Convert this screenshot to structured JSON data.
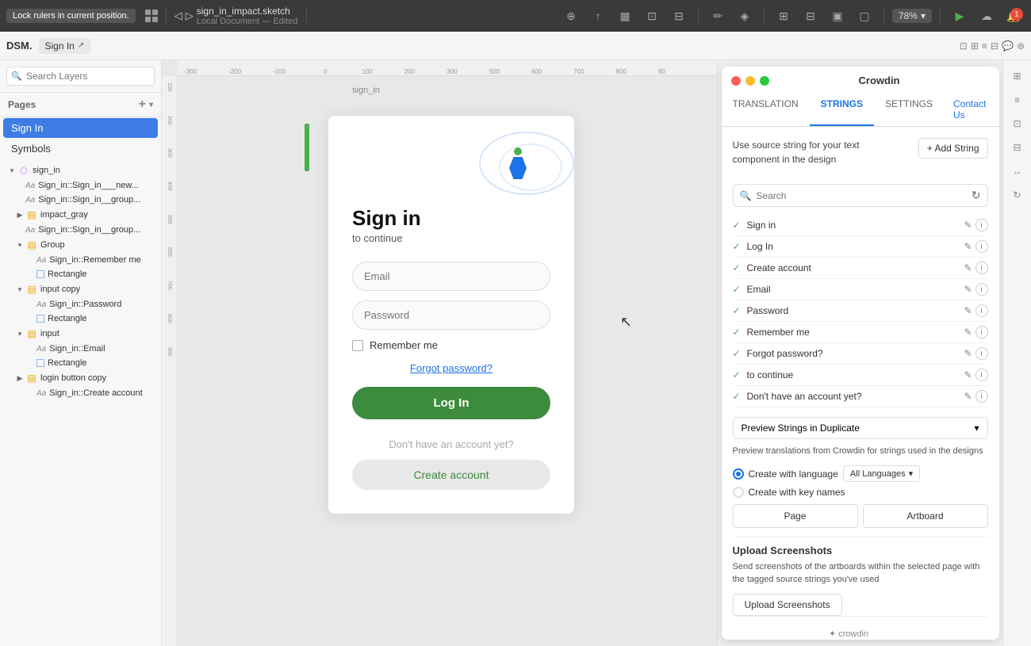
{
  "app": {
    "title": "sign_in_impact.sketch",
    "subtitle": "Local Document — Edited",
    "zoom": "78%"
  },
  "toolbar": {
    "tooltip": "Lock rulers in current position.",
    "add_icon": "+",
    "zoom_label": "78%"
  },
  "second_toolbar": {
    "dsm_label": "DSM.",
    "page_title": "Sign In",
    "external_icon": "↗"
  },
  "sidebar": {
    "search_placeholder": "Search Layers",
    "pages_label": "Pages",
    "pages": [
      {
        "label": "Sign In",
        "active": true
      },
      {
        "label": "Symbols",
        "active": false
      }
    ],
    "layers": [
      {
        "indent": 0,
        "type": "group",
        "expand": true,
        "label": "sign_in"
      },
      {
        "indent": 1,
        "type": "text",
        "label": "Sign_in::Sign_in___new..."
      },
      {
        "indent": 1,
        "type": "text",
        "label": "Sign_in::Sign_in__group..."
      },
      {
        "indent": 1,
        "type": "group",
        "label": "impact_gray"
      },
      {
        "indent": 1,
        "type": "text",
        "label": "Sign_in::Sign_in__group..."
      },
      {
        "indent": 1,
        "type": "group",
        "expand": true,
        "label": "Group"
      },
      {
        "indent": 2,
        "type": "text",
        "label": "Sign_in::Remember me"
      },
      {
        "indent": 2,
        "type": "rect",
        "label": "Rectangle"
      },
      {
        "indent": 1,
        "type": "group",
        "expand": true,
        "label": "input copy"
      },
      {
        "indent": 2,
        "type": "text",
        "label": "Sign_in::Password"
      },
      {
        "indent": 2,
        "type": "rect",
        "label": "Rectangle"
      },
      {
        "indent": 1,
        "type": "group",
        "expand": true,
        "label": "input"
      },
      {
        "indent": 2,
        "type": "text",
        "label": "Sign_in::Email"
      },
      {
        "indent": 2,
        "type": "rect",
        "label": "Rectangle"
      },
      {
        "indent": 1,
        "type": "group",
        "expand": false,
        "label": "login button copy"
      },
      {
        "indent": 2,
        "type": "text",
        "label": "Sign_in::Create account"
      }
    ]
  },
  "canvas": {
    "artboard_label": "sign_in"
  },
  "sign_in_form": {
    "title": "Sign in",
    "subtitle": "to continue",
    "email_placeholder": "Email",
    "password_placeholder": "Password",
    "remember_label": "Remember me",
    "forgot_label": "Forgot password?",
    "login_btn": "Log In",
    "no_account": "Don't have an account yet?",
    "create_account_btn": "Create account"
  },
  "crowdin_panel": {
    "title": "Crowdin",
    "tabs": [
      {
        "label": "TRANSLATION",
        "active": false
      },
      {
        "label": "STRINGS",
        "active": true
      },
      {
        "label": "SETTINGS",
        "active": false
      }
    ],
    "contact_us": "Contact Us",
    "description": "Use source string for your text component in the design",
    "add_string_btn": "+ Add String",
    "search_placeholder": "Search",
    "strings": [
      {
        "label": "Sign in"
      },
      {
        "label": "Log In"
      },
      {
        "label": "Create account"
      },
      {
        "label": "Email"
      },
      {
        "label": "Password"
      },
      {
        "label": "Remember me"
      },
      {
        "label": "Forgot password?"
      },
      {
        "label": "to continue"
      },
      {
        "label": "Don't have an account yet?"
      }
    ],
    "preview_dropdown_label": "Preview Strings in Duplicate",
    "preview_desc": "Preview translations from Crowdin for strings used in the designs",
    "radio_language": "Create with language",
    "radio_keynames": "Create with key names",
    "lang_dropdown": "All Languages",
    "page_btn": "Page",
    "artboard_btn": "Artboard",
    "upload_title": "Upload Screenshots",
    "upload_desc": "Send screenshots of the artboards within the selected page with the tagged source strings you've used",
    "upload_btn": "Upload Screenshots",
    "crowdin_logo_text": "✦ crowdin"
  }
}
